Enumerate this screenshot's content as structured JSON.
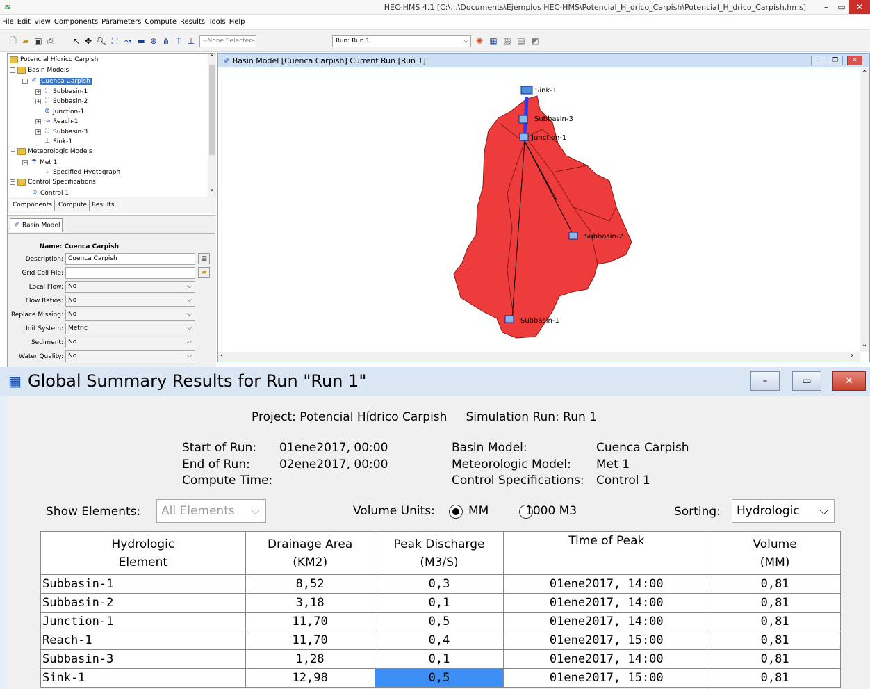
{
  "app": {
    "title": "HEC-HMS 4.1 [C:\\...\\Documents\\Ejemplos HEC-HMS\\Potencial_H_drico_Carpish\\Potencial_H_drico_Carpish.hms]"
  },
  "menu": [
    "File",
    "Edit",
    "View",
    "Components",
    "Parameters",
    "Compute",
    "Results",
    "Tools",
    "Help"
  ],
  "toolbar": {
    "selected_element": "--None Selected--",
    "run": "Run: Run 1"
  },
  "tree": {
    "root": "Potencial Hídrico Carpish",
    "basin_models": "Basin Models",
    "basin": "Cuenca Carpish",
    "elements": [
      "Subbasin-1",
      "Subbasin-2",
      "Junction-1",
      "Reach-1",
      "Subbasin-3",
      "Sink-1"
    ],
    "met_models": "Meteorologic Models",
    "met1": "Met 1",
    "hyeto": "Specified Hyetograph",
    "control_specs": "Control Specifications",
    "control1": "Control 1"
  },
  "left_tabs": [
    "Components",
    "Compute",
    "Results"
  ],
  "props": {
    "tab": "Basin Model",
    "name_label": "Name:",
    "name": "Cuenca Carpish",
    "rows": [
      {
        "label": "Description:",
        "value": "Cuenca Carpish"
      },
      {
        "label": "Grid Cell File:",
        "value": ""
      },
      {
        "label": "Local Flow:",
        "value": "No"
      },
      {
        "label": "Flow Ratios:",
        "value": "No"
      },
      {
        "label": "Replace Missing:",
        "value": "No"
      },
      {
        "label": "Unit System:",
        "value": "Metric"
      },
      {
        "label": "Sediment:",
        "value": "No"
      },
      {
        "label": "Water Quality:",
        "value": "No"
      }
    ]
  },
  "map": {
    "title": "Basin Model [Cuenca Carpish] Current Run [Run 1]",
    "fill_color": "#ee3b3b",
    "labels": {
      "sink": "Sink-1",
      "sub3": "Subbasin-3",
      "junction": "Junction-1",
      "sub2": "Subbasin-2",
      "sub1": "Subbasin-1"
    }
  },
  "summary": {
    "title": "Global Summary Results for Run \"Run 1\"",
    "project_line": "Project: Potencial Hídrico Carpish     Simulation Run: Run 1",
    "start_label": "Start of Run:",
    "start": "01ene2017, 00:00",
    "end_label": "End of Run:",
    "end": "02ene2017, 00:00",
    "compute_label": "Compute Time:",
    "basin_label": "Basin Model:",
    "basin": "Cuenca Carpish",
    "met_label": "Meteorologic Model:",
    "met": "Met 1",
    "ctrl_label": "Control Specifications:",
    "ctrl": "Control 1",
    "show_label": "Show Elements:",
    "show_value": "All Elements",
    "vol_label": "Volume Units:",
    "vol_opt1": "MM",
    "vol_opt2": "1000 M3",
    "sort_label": "Sorting:",
    "sort_value": "Hydrologic",
    "headers": [
      [
        "Hydrologic",
        "Element"
      ],
      [
        "Drainage Area",
        "(KM2)"
      ],
      [
        "Peak Discharge",
        "(M3/S)"
      ],
      [
        "Time of Peak",
        ""
      ],
      [
        "Volume",
        "(MM)"
      ]
    ],
    "rows": [
      [
        "Subbasin-1",
        "8,52",
        "0,3",
        "01ene2017, 14:00",
        "0,81"
      ],
      [
        "Subbasin-2",
        "3,18",
        "0,1",
        "01ene2017, 14:00",
        "0,81"
      ],
      [
        "Junction-1",
        "11,70",
        "0,5",
        "01ene2017, 14:00",
        "0,81"
      ],
      [
        "Reach-1",
        "11,70",
        "0,4",
        "01ene2017, 15:00",
        "0,81"
      ],
      [
        "Subbasin-3",
        "1,28",
        "0,1",
        "01ene2017, 14:00",
        "0,81"
      ],
      [
        "Sink-1",
        "12,98",
        "0,5",
        "01ene2017, 15:00",
        "0,81"
      ]
    ]
  }
}
